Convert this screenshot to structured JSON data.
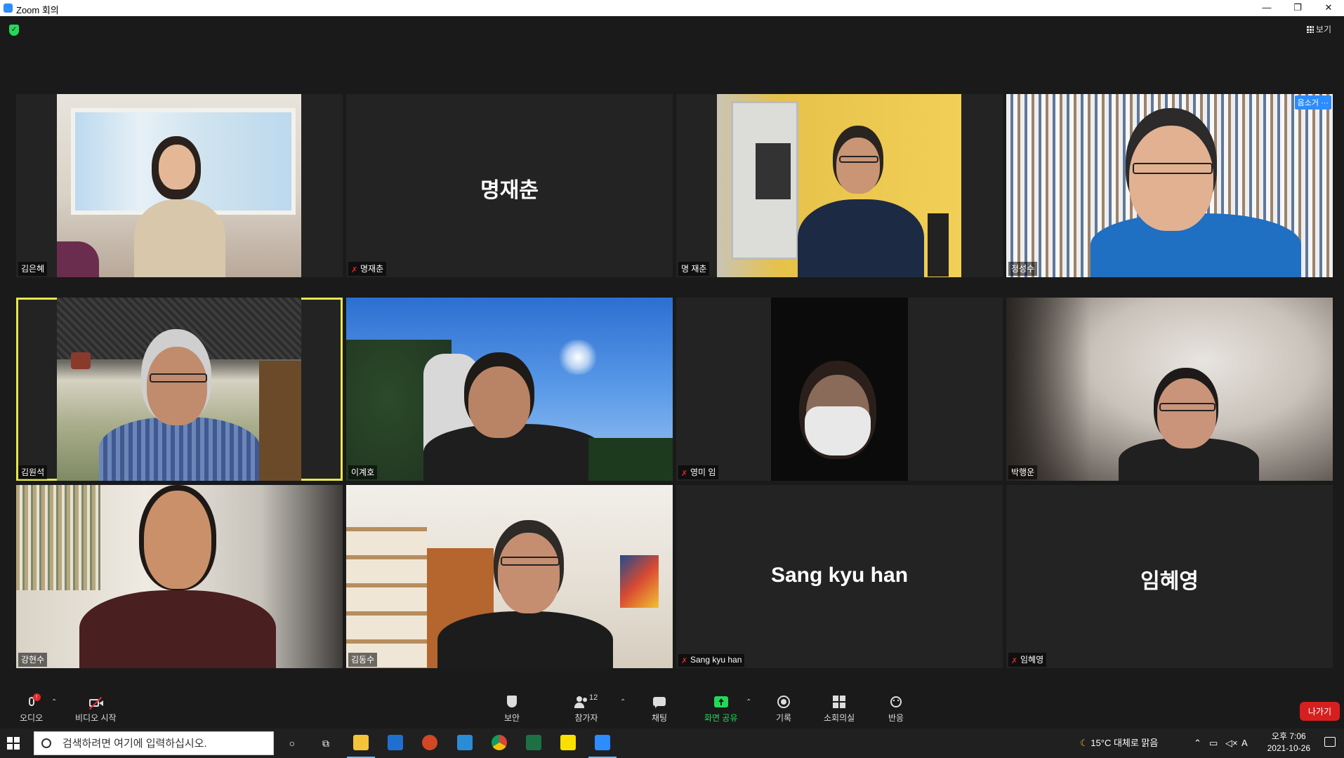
{
  "window": {
    "title": "Zoom 회의",
    "minimize": "—",
    "restore": "❐",
    "close": "✕"
  },
  "meeting": {
    "view_label": "보기",
    "tiles": [
      {
        "name": "김은혜",
        "muted": false,
        "kind": "video"
      },
      {
        "name": "명재춘",
        "muted": true,
        "kind": "name",
        "display_name": "명재춘"
      },
      {
        "name": "명 재춘",
        "muted": false,
        "kind": "video"
      },
      {
        "name": "정성수",
        "muted": false,
        "kind": "video",
        "badge": "음소거 ···"
      },
      {
        "name": "김원석",
        "muted": false,
        "kind": "video",
        "active": true
      },
      {
        "name": "이계호",
        "muted": false,
        "kind": "video"
      },
      {
        "name": "영미 임",
        "muted": true,
        "kind": "video"
      },
      {
        "name": "박행운",
        "muted": false,
        "kind": "video"
      },
      {
        "name": "강현수",
        "muted": false,
        "kind": "video"
      },
      {
        "name": "김동수",
        "muted": false,
        "kind": "video"
      },
      {
        "name": "Sang kyu han",
        "muted": true,
        "kind": "name",
        "display_name": "Sang kyu han"
      },
      {
        "name": "임혜영",
        "muted": true,
        "kind": "name",
        "display_name": "임혜영"
      }
    ]
  },
  "toolbar": {
    "audio": "오디오",
    "video": "비디오 시작",
    "security": "보안",
    "participants": "참가자",
    "participants_count": "12",
    "chat": "채팅",
    "share": "화면 공유",
    "record": "기록",
    "breakout": "소회의실",
    "reactions": "반응",
    "leave": "나가기"
  },
  "taskbar": {
    "search_placeholder": "검색하려면 여기에 입력하십시오.",
    "weather": "15°C  대체로 맑음",
    "ime": "A",
    "time": "오후 7:06",
    "date": "2021-10-26"
  },
  "colors": {
    "accent": "#2d8cff",
    "leave": "#d6201f",
    "active_speaker": "#e6e64a",
    "share": "#23d959"
  }
}
